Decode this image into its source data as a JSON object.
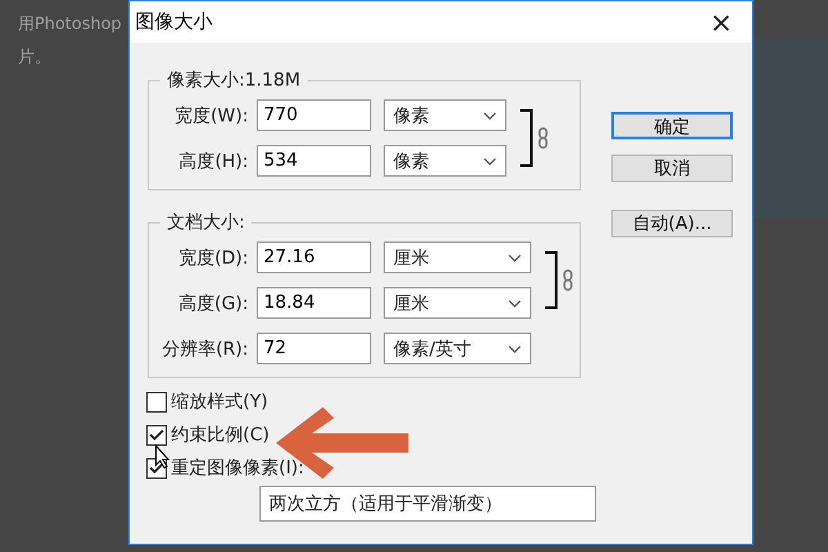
{
  "page_text": [
    "用Photoshop",
    "片。"
  ],
  "window": {
    "title": "图像大小",
    "close": "×"
  },
  "pixel_group": {
    "title": "像素大小:1.18M",
    "rows": [
      {
        "label": "宽度(W):",
        "value": "770",
        "unit": "像素"
      },
      {
        "label": "高度(H):",
        "value": "534",
        "unit": "像素"
      }
    ],
    "linked": true
  },
  "document_group": {
    "title": "文档大小:",
    "rows": [
      {
        "label": "宽度(D):",
        "value": "27.16",
        "unit": "厘米",
        "linked": true
      },
      {
        "label": "高度(G):",
        "value": "18.84",
        "unit": "厘米",
        "linked": true
      },
      {
        "label": "分辨率(R):",
        "value": "72",
        "unit": "像素/英寸",
        "linked": false
      }
    ]
  },
  "buttons": [
    {
      "label": "确定",
      "default": true
    },
    {
      "label": "取消",
      "default": false
    },
    {
      "label": "自动(A)...",
      "default": false
    }
  ],
  "options": [
    {
      "label": "缩放样式(Y)",
      "checked": false
    },
    {
      "label": "约束比例(C)",
      "checked": true
    },
    {
      "label": "重定图像像素(I):",
      "checked": true
    }
  ],
  "resample_method": "两次立方（适用于平滑渐变）"
}
